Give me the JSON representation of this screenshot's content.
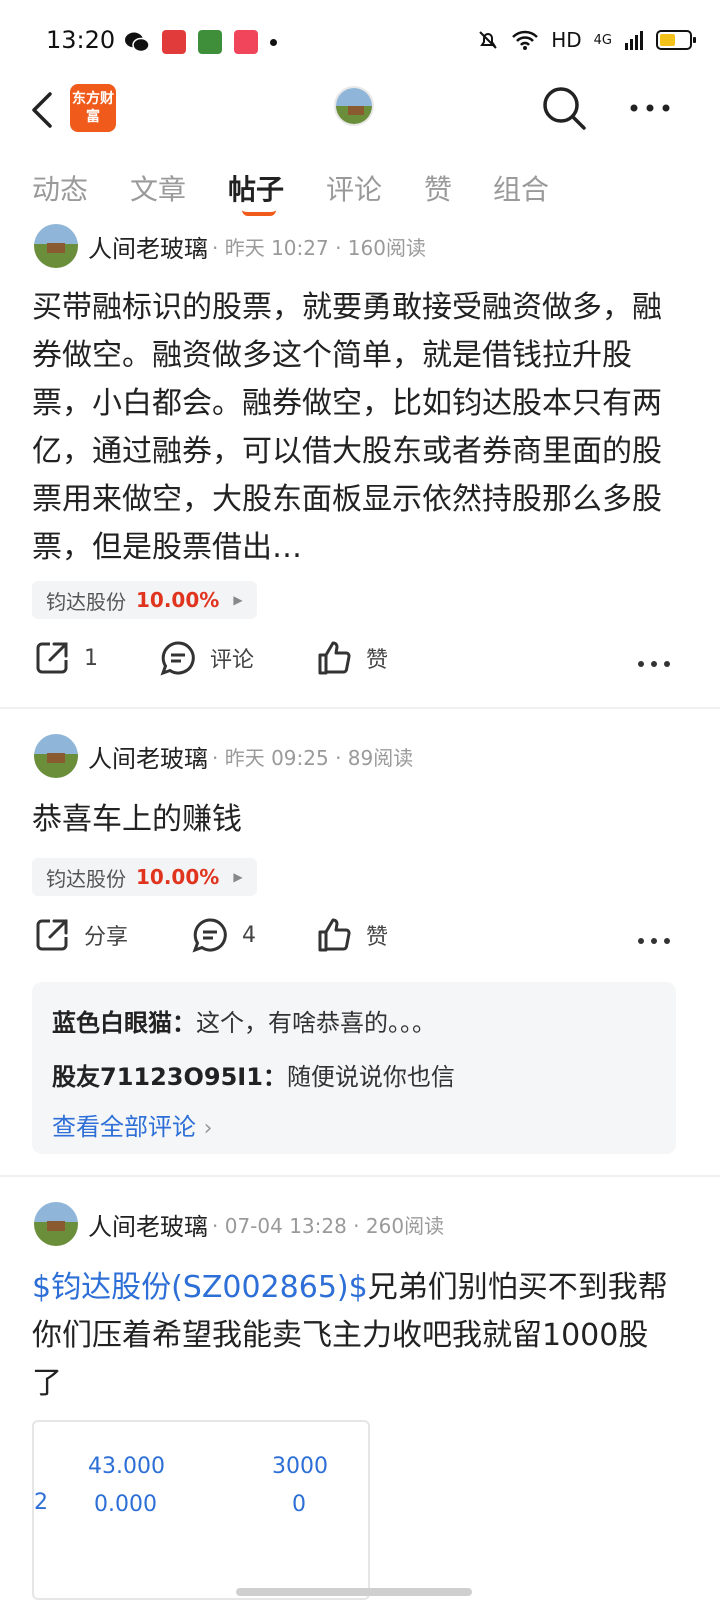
{
  "status_bar": {
    "time": "13:20",
    "network": "HD",
    "signal": "4G",
    "battery_level": 0.55
  },
  "header": {
    "logo_text": "东方财富"
  },
  "tabs": [
    {
      "label": "动态",
      "active": false
    },
    {
      "label": "文章",
      "active": false
    },
    {
      "label": "帖子",
      "active": true
    },
    {
      "label": "评论",
      "active": false
    },
    {
      "label": "赞",
      "active": false
    },
    {
      "label": "组合",
      "active": false
    }
  ],
  "posts": [
    {
      "author": "人间老玻璃",
      "meta": "· 昨天 10:27 · 160阅读",
      "body": "买带融标识的股票，就要勇敢接受融资做多，融券做空。融资做多这个简单，就是借钱拉升股票，小白都会。融券做空，比如钧达股本只有两亿，通过融券，可以借大股东或者券商里面的股票用来做空，大股东面板显示依然持股那么多股票，但是股票借出…",
      "stock": {
        "name": "钧达股份",
        "change": "10.00%"
      },
      "actions": {
        "share": "1",
        "comment": "评论",
        "like": "赞"
      }
    },
    {
      "author": "人间老玻璃",
      "meta": "· 昨天 09:25 · 89阅读",
      "body": "恭喜车上的赚钱",
      "stock": {
        "name": "钧达股份",
        "change": "10.00%"
      },
      "actions": {
        "share": "分享",
        "comment": "4",
        "like": "赞"
      },
      "comments": [
        {
          "user": "蓝色白眼猫：",
          "text": "这个，有啥恭喜的。。。"
        },
        {
          "user": "股友71123O95I1：",
          "text": "随便说说你也信"
        }
      ],
      "view_all": "查看全部评论"
    },
    {
      "author": "人间老玻璃",
      "meta": "· 07-04 13:28 · 260阅读",
      "stock_link": "$钧达股份(SZ002865)$",
      "body": "兄弟们别怕买不到我帮你们压着希望我能卖飞主力收吧我就留1000股了",
      "image_values": {
        "v1": "43.000",
        "v2": "3000",
        "v3": "0.000",
        "v4": "0",
        "edge": "2"
      }
    }
  ]
}
